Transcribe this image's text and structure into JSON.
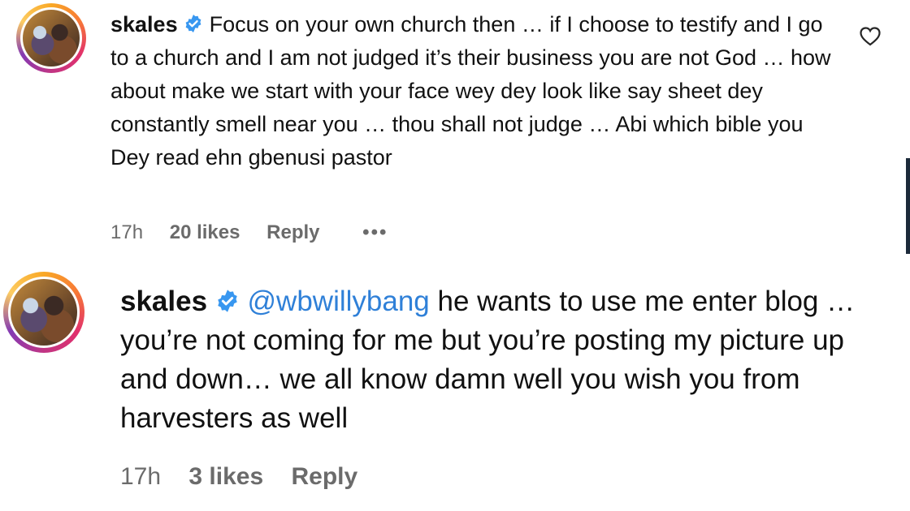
{
  "comments": [
    {
      "username": "skales",
      "mention": "",
      "text": "Focus on your own church then … if I choose to testify and I go to a church and I am not judged it’s their business you are not God … how about make we start with your face wey dey look like say sheet dey constantly smell near you … thou shall not judge … Abi which bible you Dey read ehn gbenusi pastor",
      "time": "17h",
      "likes": "20 likes",
      "reply": "Reply",
      "more": "•••"
    },
    {
      "username": "skales",
      "mention": "@wbwillybang",
      "text": " he wants to use me enter blog … you’re not coming for me but you’re posting my picture up and down… we all know damn well you wish you from harvesters as well",
      "time": "17h",
      "likes": "3 likes",
      "reply": "Reply"
    }
  ],
  "colors": {
    "mention": "#2f80d8",
    "meta": "#6b6b6b",
    "verified": "#3897f0"
  },
  "icons": {
    "verified": "verified-badge-icon",
    "like": "heart-icon",
    "more": "more-options-icon"
  }
}
